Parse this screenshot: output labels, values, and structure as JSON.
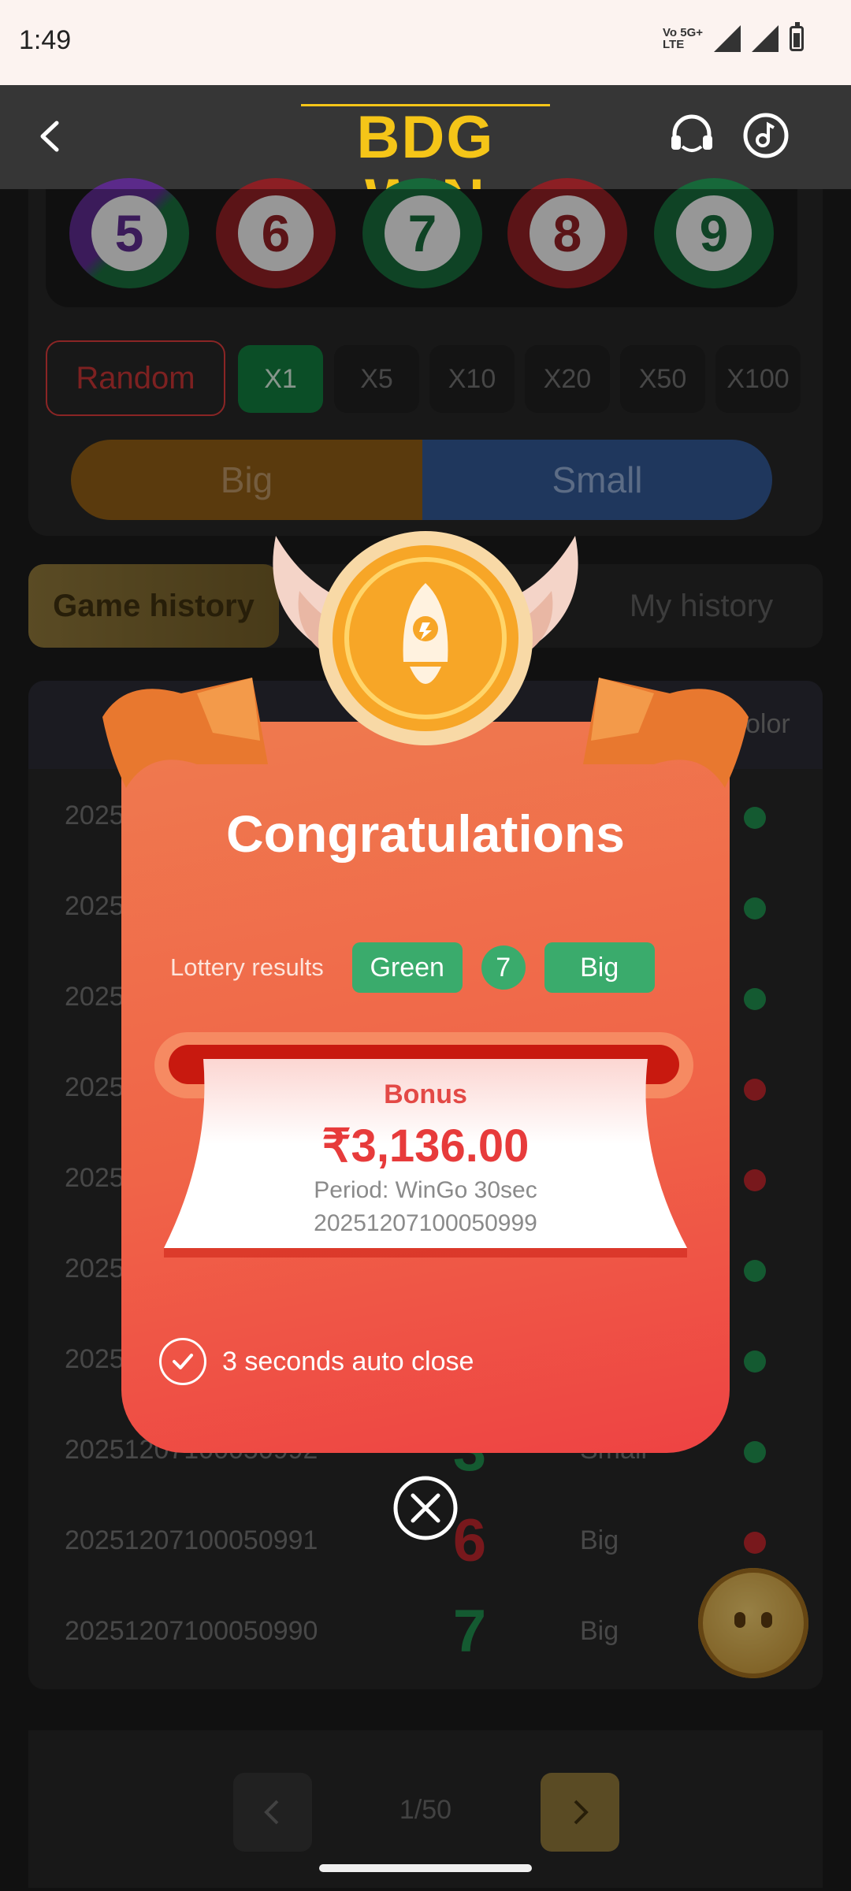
{
  "status_bar": {
    "time": "1:49",
    "network_top": "Vo 5G+",
    "network_bottom": "LTE"
  },
  "header": {
    "logo_text": "BDG WIN",
    "back_icon": "chevron-left-icon",
    "support_icon": "headset-icon",
    "music_icon": "music-note-icon"
  },
  "balls": [
    {
      "number": "5",
      "color": "purple-green"
    },
    {
      "number": "6",
      "color": "red"
    },
    {
      "number": "7",
      "color": "green"
    },
    {
      "number": "8",
      "color": "red"
    },
    {
      "number": "9",
      "color": "green"
    }
  ],
  "controls": {
    "random_label": "Random",
    "multipliers": [
      "X1",
      "X5",
      "X10",
      "X20",
      "X50",
      "X100"
    ],
    "active_multiplier": "X1",
    "big_label": "Big",
    "small_label": "Small"
  },
  "history_tabs": {
    "game_history": "Game history",
    "my_history": "My history"
  },
  "table": {
    "header_color": "olor",
    "rows": [
      {
        "period": "2025",
        "number": "",
        "size": "",
        "dot": "#1f8a4c"
      },
      {
        "period": "2025",
        "number": "",
        "size": "",
        "dot": "#1f8a4c"
      },
      {
        "period": "2025",
        "number": "",
        "size": "",
        "dot": "#1f8a4c"
      },
      {
        "period": "2025",
        "number": "",
        "size": "",
        "dot": "#b8262b"
      },
      {
        "period": "2025",
        "number": "",
        "size": "",
        "dot": "#b8262b"
      },
      {
        "period": "2025",
        "number": "",
        "size": "",
        "dot": "#1f8a4c"
      },
      {
        "period": "2025",
        "number": "",
        "size": "",
        "dot": "#1f8a4c"
      },
      {
        "period": "20251207100050992",
        "number": "3",
        "size": "Small",
        "dot": "#1f8a4c"
      },
      {
        "period": "20251207100050991",
        "number": "6",
        "size": "Big",
        "dot": "#b8262b"
      },
      {
        "period": "20251207100050990",
        "number": "7",
        "size": "Big",
        "dot": "#1f8a4c"
      }
    ]
  },
  "pager": {
    "text": "1/50"
  },
  "modal": {
    "title": "Congratulations",
    "lottery_label": "Lottery results",
    "result_color": "Green",
    "result_number": "7",
    "result_size": "Big",
    "bonus_label": "Bonus",
    "amount": "₹3,136.00",
    "period_label": "Period: WinGo 30sec",
    "period_id": "20251207100050999",
    "auto_close": "3 seconds auto close"
  },
  "colors": {
    "accent_gold": "#f5c518",
    "green": "#3aab6c",
    "red": "#e73b3b"
  }
}
